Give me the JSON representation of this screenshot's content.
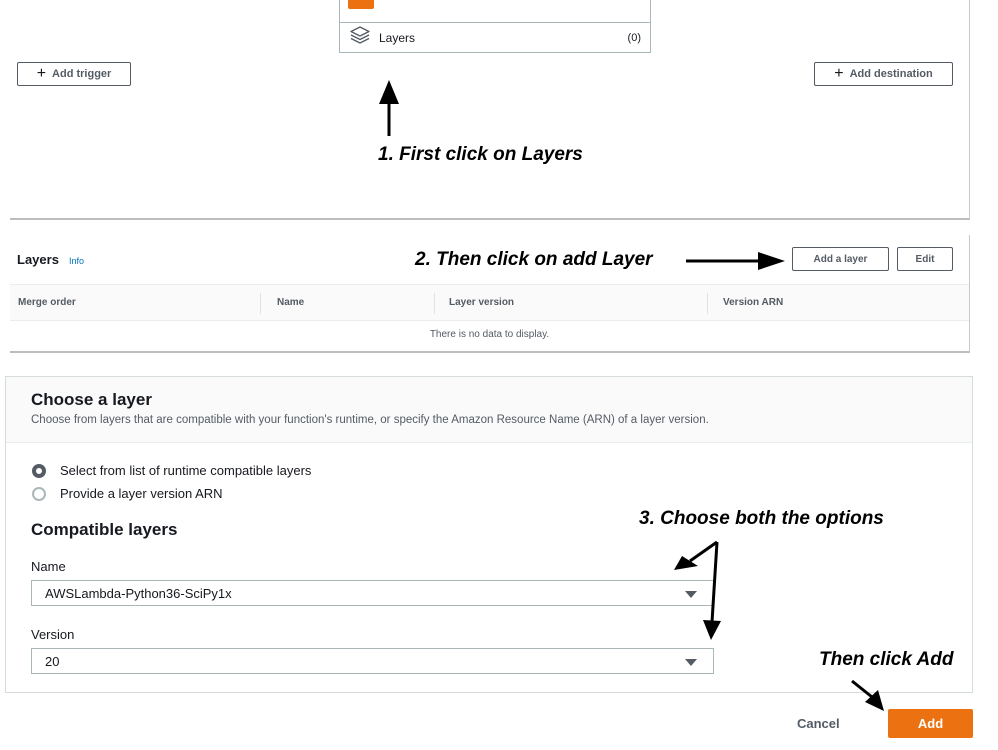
{
  "designer": {
    "layers_label": "Layers",
    "layers_count": "(0)",
    "add_trigger": "Add trigger",
    "add_destination": "Add destination"
  },
  "layers_panel": {
    "title": "Layers",
    "info": "Info",
    "add_layer_button": "Add a layer",
    "edit_button": "Edit",
    "columns": [
      "Merge order",
      "Name",
      "Layer version",
      "Version ARN"
    ],
    "empty_text": "There is no data to display."
  },
  "choose_layer": {
    "title": "Choose a layer",
    "description": "Choose from layers that are compatible with your function's runtime, or specify the Amazon Resource Name (ARN) of a layer version.",
    "options": [
      {
        "label": "Select from list of runtime compatible layers",
        "selected": true
      },
      {
        "label": "Provide a layer version ARN",
        "selected": false
      }
    ],
    "compatible_title": "Compatible layers",
    "name_label": "Name",
    "name_value": "AWSLambda-Python36-SciPy1x",
    "version_label": "Version",
    "version_value": "20"
  },
  "footer": {
    "cancel": "Cancel",
    "add": "Add"
  },
  "annotations": {
    "step1": "1. First click on Layers",
    "step2": "2. Then click on add Layer",
    "step3": "3. Choose both the options",
    "step4": "Then click Add"
  },
  "colors": {
    "accent": "#ec7211",
    "link": "#0073bb",
    "text": "#16191f",
    "muted": "#545b64"
  }
}
